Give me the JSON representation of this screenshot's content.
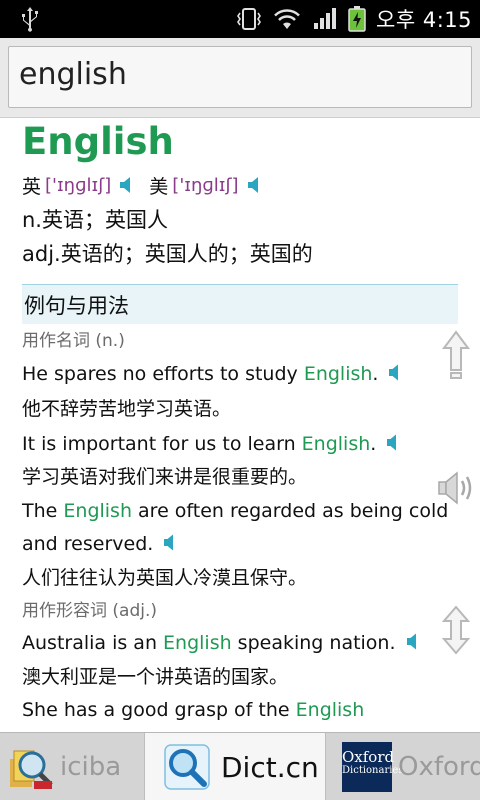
{
  "status_bar": {
    "time": "오후 4:15",
    "icons": [
      "usb-icon",
      "vibrate-icon",
      "wifi-icon",
      "signal-icon",
      "battery-charging-icon"
    ]
  },
  "search": {
    "query": "english"
  },
  "entry": {
    "headword": "English",
    "pron": [
      {
        "label": "英",
        "ipa": "['ɪŋɡlɪʃ]"
      },
      {
        "label": "美",
        "ipa": "['ɪŋɡlɪʃ]"
      }
    ],
    "definitions": [
      "n.英语；英国人",
      "adj.英语的；英国人的；英国的"
    ]
  },
  "usage": {
    "section_title": "例句与用法",
    "noun_heading": "用作名词 (n.)",
    "adj_heading": "用作形容词 (adj.)",
    "examples": [
      {
        "en_before": "He spares no efforts to study ",
        "highlight": "English",
        "en_after": ".",
        "zh": "他不辞劳苦地学习英语。"
      },
      {
        "en_before": "It is important for us to learn ",
        "highlight": "English",
        "en_after": ".",
        "zh": "学习英语对我们来讲是很重要的。"
      },
      {
        "en_before": "The ",
        "highlight": "English",
        "en_after": " are often regarded as being cold and reserved.",
        "zh": "人们往往认为英国人冷漠且保守。"
      },
      {
        "en_before": "Australia is an ",
        "highlight": "English",
        "en_after": " speaking nation.",
        "zh": "澳大利亚是一个讲英语的国家。"
      },
      {
        "en_before": "She has a good grasp of the ",
        "highlight": "English",
        "en_after": "",
        "zh": ""
      }
    ]
  },
  "tabs": [
    {
      "label": "iciba",
      "icon": "iciba-icon",
      "selected": false
    },
    {
      "label": "Dict.cn",
      "icon": "dictcn-magnifier-icon",
      "selected": true
    },
    {
      "label": "Oxford",
      "icon": "oxford-dictionaries-logo",
      "logo_text": [
        "Oxford",
        "Dictionaries"
      ],
      "selected": false
    }
  ],
  "colors": {
    "headword": "#1f9a52",
    "ipa": "#8b3a8b",
    "speaker": "#2aa6c0",
    "section_bg": "#e8f4f8"
  }
}
